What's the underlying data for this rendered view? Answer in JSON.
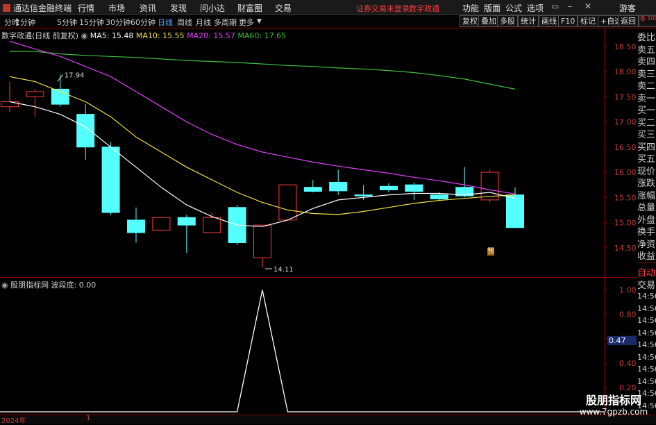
{
  "app": {
    "title": "通达信金融终端"
  },
  "menu": {
    "items": [
      "行情",
      "市场",
      "资讯",
      "发现",
      "问小达",
      "财富圈",
      "交易"
    ],
    "status_warning": "证券交易未登录",
    "stock_name": "数字政通",
    "right_items": [
      "功能",
      "版面",
      "公式",
      "选项"
    ],
    "guest": "游客"
  },
  "toolbar": {
    "periods": [
      "分时",
      "1分钟",
      "5分钟",
      "15分钟",
      "30分钟",
      "60分钟",
      "日线",
      "周线",
      "月线",
      "多周期",
      "更多"
    ],
    "active_period": "日线",
    "buttons": [
      "复权",
      "叠加",
      "多股",
      "统计",
      "画线",
      "F10",
      "标记",
      "+自选",
      "返回"
    ]
  },
  "main_chart": {
    "header": "数字政通(日线 前复权)",
    "ma": [
      {
        "label": "MA5: 15.48",
        "color": "#ffffff"
      },
      {
        "label": "MA10: 15.55",
        "color": "#f5e042"
      },
      {
        "label": "MA20: 15.57",
        "color": "#e040fb"
      },
      {
        "label": "MA60: 17.65",
        "color": "#3fbf3f"
      }
    ],
    "high_marker": "17.94",
    "low_marker": "14.11",
    "yi_badge": "预",
    "y_ticks": [
      "18.50",
      "18.00",
      "17.50",
      "17.00",
      "16.50",
      "16.00",
      "15.50",
      "15.00",
      "14.50"
    ]
  },
  "chart_data": [
    {
      "type": "candlestick",
      "title": "数字政通(日线 前复权)",
      "ylim": [
        14.0,
        18.8
      ],
      "candles": [
        {
          "o": 17.3,
          "c": 17.4,
          "h": 17.8,
          "l": 17.2
        },
        {
          "o": 17.5,
          "c": 17.6,
          "h": 17.65,
          "l": 17.1
        },
        {
          "o": 17.65,
          "c": 17.35,
          "h": 17.94,
          "l": 17.3
        },
        {
          "o": 17.15,
          "c": 16.5,
          "h": 17.35,
          "l": 16.25
        },
        {
          "o": 16.5,
          "c": 15.2,
          "h": 16.6,
          "l": 15.15
        },
        {
          "o": 15.05,
          "c": 14.8,
          "h": 15.3,
          "l": 14.6
        },
        {
          "o": 14.85,
          "c": 15.1,
          "h": 15.1,
          "l": 14.85
        },
        {
          "o": 15.1,
          "c": 14.95,
          "h": 15.15,
          "l": 14.4
        },
        {
          "o": 14.8,
          "c": 15.1,
          "h": 15.2,
          "l": 14.8
        },
        {
          "o": 15.3,
          "c": 14.6,
          "h": 15.35,
          "l": 14.55
        },
        {
          "o": 14.3,
          "c": 14.95,
          "h": 14.95,
          "l": 14.11
        },
        {
          "o": 15.05,
          "c": 15.75,
          "h": 15.75,
          "l": 15.05
        },
        {
          "o": 15.7,
          "c": 15.62,
          "h": 15.85,
          "l": 15.6
        },
        {
          "o": 15.8,
          "c": 15.63,
          "h": 16.05,
          "l": 15.55
        },
        {
          "o": 15.55,
          "c": 15.54,
          "h": 15.75,
          "l": 15.45
        },
        {
          "o": 15.72,
          "c": 15.65,
          "h": 15.78,
          "l": 15.6
        },
        {
          "o": 15.75,
          "c": 15.62,
          "h": 15.8,
          "l": 15.45
        },
        {
          "o": 15.55,
          "c": 15.47,
          "h": 15.6,
          "l": 15.45
        },
        {
          "o": 15.7,
          "c": 15.53,
          "h": 16.1,
          "l": 15.5
        },
        {
          "o": 15.45,
          "c": 16.0,
          "h": 16.05,
          "l": 15.4
        },
        {
          "o": 15.55,
          "c": 14.9,
          "h": 15.7,
          "l": 14.9
        }
      ],
      "ma5": [
        17.4,
        17.3,
        17.15,
        16.9,
        16.5,
        16.1,
        15.7,
        15.35,
        15.12,
        14.95,
        14.92,
        15.05,
        15.28,
        15.45,
        15.5,
        15.55,
        15.58,
        15.58,
        15.55,
        15.6,
        15.48
      ],
      "ma10": [
        17.9,
        17.8,
        17.6,
        17.4,
        17.1,
        16.7,
        16.4,
        16.1,
        15.85,
        15.6,
        15.4,
        15.25,
        15.18,
        15.16,
        15.22,
        15.3,
        15.38,
        15.44,
        15.48,
        15.52,
        15.55
      ],
      "ma20": [
        18.6,
        18.45,
        18.3,
        18.1,
        17.9,
        17.6,
        17.3,
        17.0,
        16.75,
        16.55,
        16.4,
        16.3,
        16.2,
        16.12,
        16.05,
        15.98,
        15.9,
        15.83,
        15.75,
        15.65,
        15.57
      ],
      "ma60": [
        18.4,
        18.4,
        18.35,
        18.32,
        18.3,
        18.28,
        18.25,
        18.22,
        18.2,
        18.18,
        18.15,
        18.12,
        18.1,
        18.07,
        18.05,
        18.02,
        17.98,
        17.92,
        17.85,
        17.75,
        17.65
      ]
    },
    {
      "type": "line",
      "title": "股朋指标网 波段底: 0.00",
      "ylim": [
        0,
        1.1
      ],
      "y_ticks": [
        "1.00",
        "0.80",
        "0.60",
        "0.40",
        "0.20"
      ],
      "cursor_value": "0.47",
      "values": [
        0,
        0,
        0,
        0,
        0,
        0,
        0,
        0,
        0,
        0,
        1,
        0,
        0,
        0,
        0,
        0,
        0,
        0,
        0,
        0,
        0
      ]
    }
  ],
  "sub_chart": {
    "title": "股朋指标网",
    "indicator": "波段底: 0.00"
  },
  "right_panel": {
    "top_label": "各\n1000",
    "items": [
      "委比",
      "卖五",
      "卖四",
      "卖三",
      "卖二",
      "卖一",
      "买一",
      "买二",
      "买三",
      "买四",
      "买五",
      "现价",
      "涨跌",
      "涨幅",
      "总量",
      "外盘",
      "换手",
      "净资",
      "收益"
    ],
    "auto_trade": [
      "自动",
      "交易"
    ],
    "times": [
      "14:56",
      "14:56",
      "14:56",
      "14:56",
      "14:56",
      "14:56",
      "14:56",
      "14:56",
      "14:56",
      "14:56"
    ]
  },
  "bottom": {
    "year": "2024年",
    "page": "1"
  },
  "watermark": {
    "title": "股朋指标网",
    "url": "www.7gpzb.com"
  }
}
